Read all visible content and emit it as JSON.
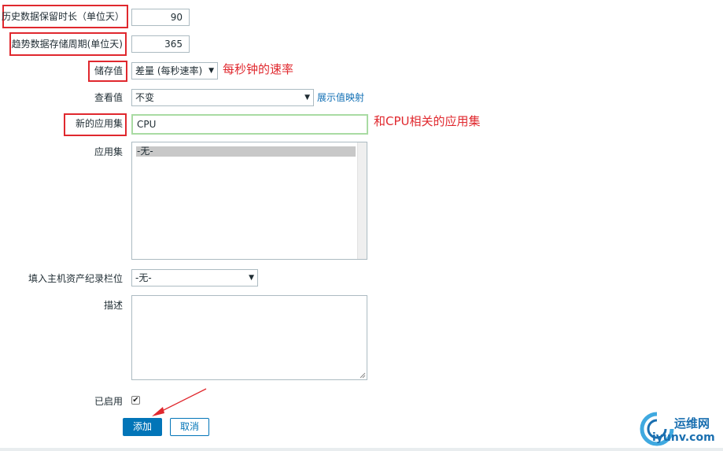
{
  "form": {
    "history": {
      "label": "历史数据保留时长（单位天）",
      "value": "90"
    },
    "trends": {
      "label": "趋势数据存储周期(单位天)",
      "value": "365"
    },
    "store_value": {
      "label": "储存值",
      "selected": "差量 (每秒速率)",
      "annotation": "每秒钟的速率"
    },
    "show_value": {
      "label": "查看值",
      "selected": "不变",
      "mapping_link": "展示值映射"
    },
    "new_application": {
      "label": "新的应用集",
      "value": "CPU",
      "annotation": "和CPU相关的应用集"
    },
    "applications": {
      "label": "应用集",
      "options": [
        "-无-"
      ],
      "selected": "-无-"
    },
    "inventory": {
      "label": "填入主机资产纪录栏位",
      "selected": "-无-"
    },
    "description": {
      "label": "描述",
      "value": ""
    },
    "enabled": {
      "label": "已启用",
      "checked": true
    }
  },
  "buttons": {
    "add": "添加",
    "cancel": "取消"
  },
  "watermark": {
    "cn": "运维网",
    "url": "iyunv.com"
  },
  "colors": {
    "annotation_red": "#e0282e",
    "primary_blue": "#0275b8",
    "link_blue": "#0f6eb4",
    "focus_green": "#a9dba3"
  }
}
